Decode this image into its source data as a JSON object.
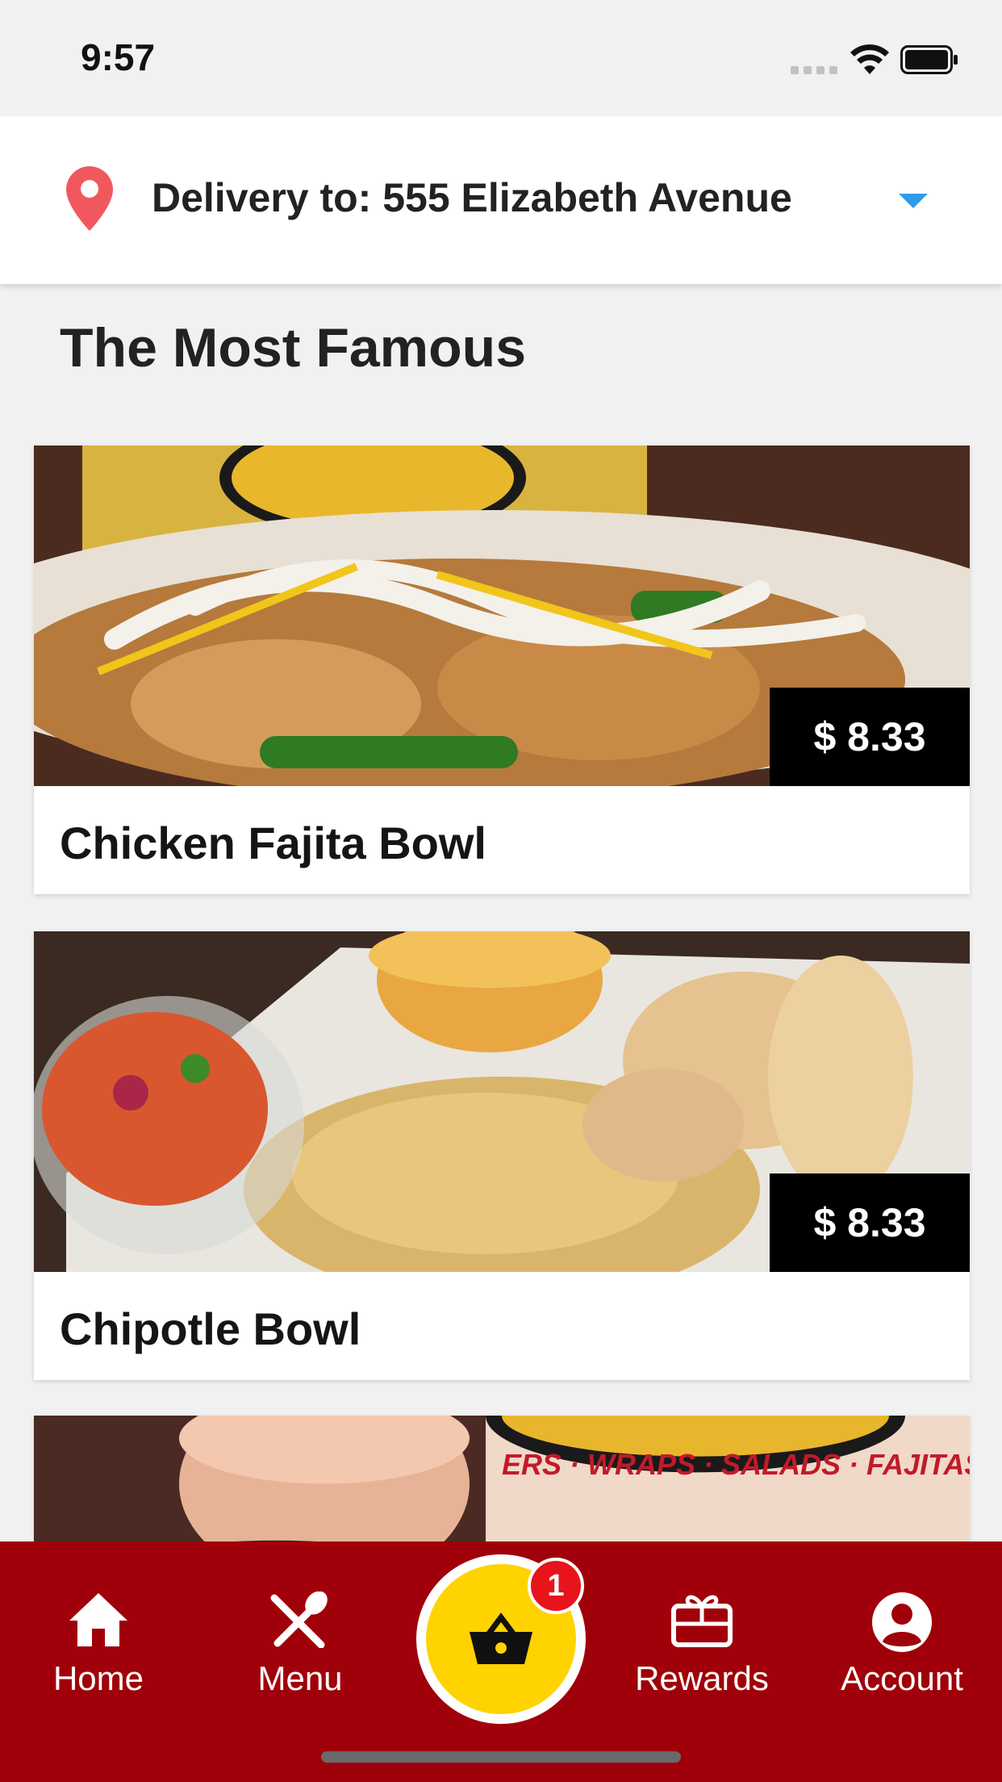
{
  "status_bar": {
    "time": "9:57"
  },
  "delivery": {
    "label": "Delivery to: 555 Elizabeth Avenue"
  },
  "section": {
    "title": "The Most Famous"
  },
  "products": [
    {
      "name": "Chicken Fajita Bowl",
      "price": "$ 8.33"
    },
    {
      "name": "Chipotle Bowl",
      "price": "$ 8.33"
    }
  ],
  "third_card_image_text": "ERS · WRAPS · SALADS · FAJITAS",
  "nav": {
    "home": "Home",
    "menu": "Menu",
    "rewards": "Rewards",
    "account": "Account",
    "cart_count": "1"
  },
  "colors": {
    "nav_bg": "#a00009",
    "cart_button": "#ffd300",
    "badge": "#e8141c",
    "pin": "#f0585e",
    "caret": "#2e9be6"
  },
  "icons": [
    "location-pin-icon",
    "dropdown-caret-icon",
    "home-icon",
    "menu-utensils-icon",
    "basket-icon",
    "gift-icon",
    "account-icon",
    "wifi-icon",
    "battery-icon",
    "signal-icon"
  ]
}
